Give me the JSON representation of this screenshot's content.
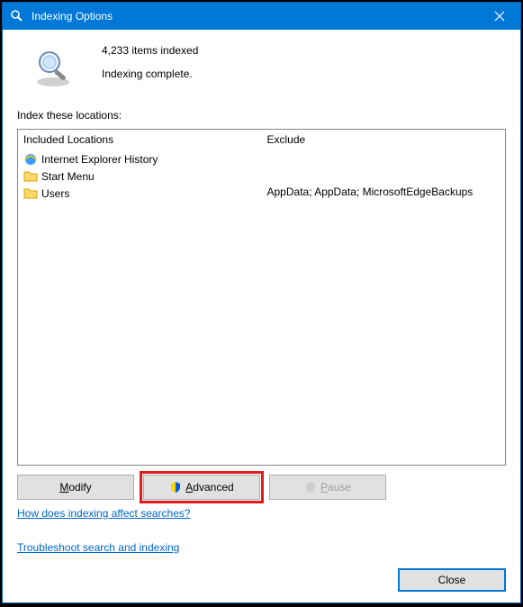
{
  "titlebar": {
    "title": "Indexing Options"
  },
  "status": {
    "count_line": "4,233 items indexed",
    "state_line": "Indexing complete."
  },
  "section_label": "Index these locations:",
  "columns": {
    "included_header": "Included Locations",
    "exclude_header": "Exclude"
  },
  "locations": [
    {
      "icon": "ie",
      "label": "Internet Explorer History",
      "exclude": ""
    },
    {
      "icon": "folder",
      "label": "Start Menu",
      "exclude": ""
    },
    {
      "icon": "folder",
      "label": "Users",
      "exclude": "AppData; AppData; MicrosoftEdgeBackups"
    }
  ],
  "buttons": {
    "modify": "Modify",
    "advanced": "Advanced",
    "pause": "Pause",
    "close": "Close"
  },
  "links": {
    "how": "How does indexing affect searches?",
    "troubleshoot": "Troubleshoot search and indexing"
  }
}
